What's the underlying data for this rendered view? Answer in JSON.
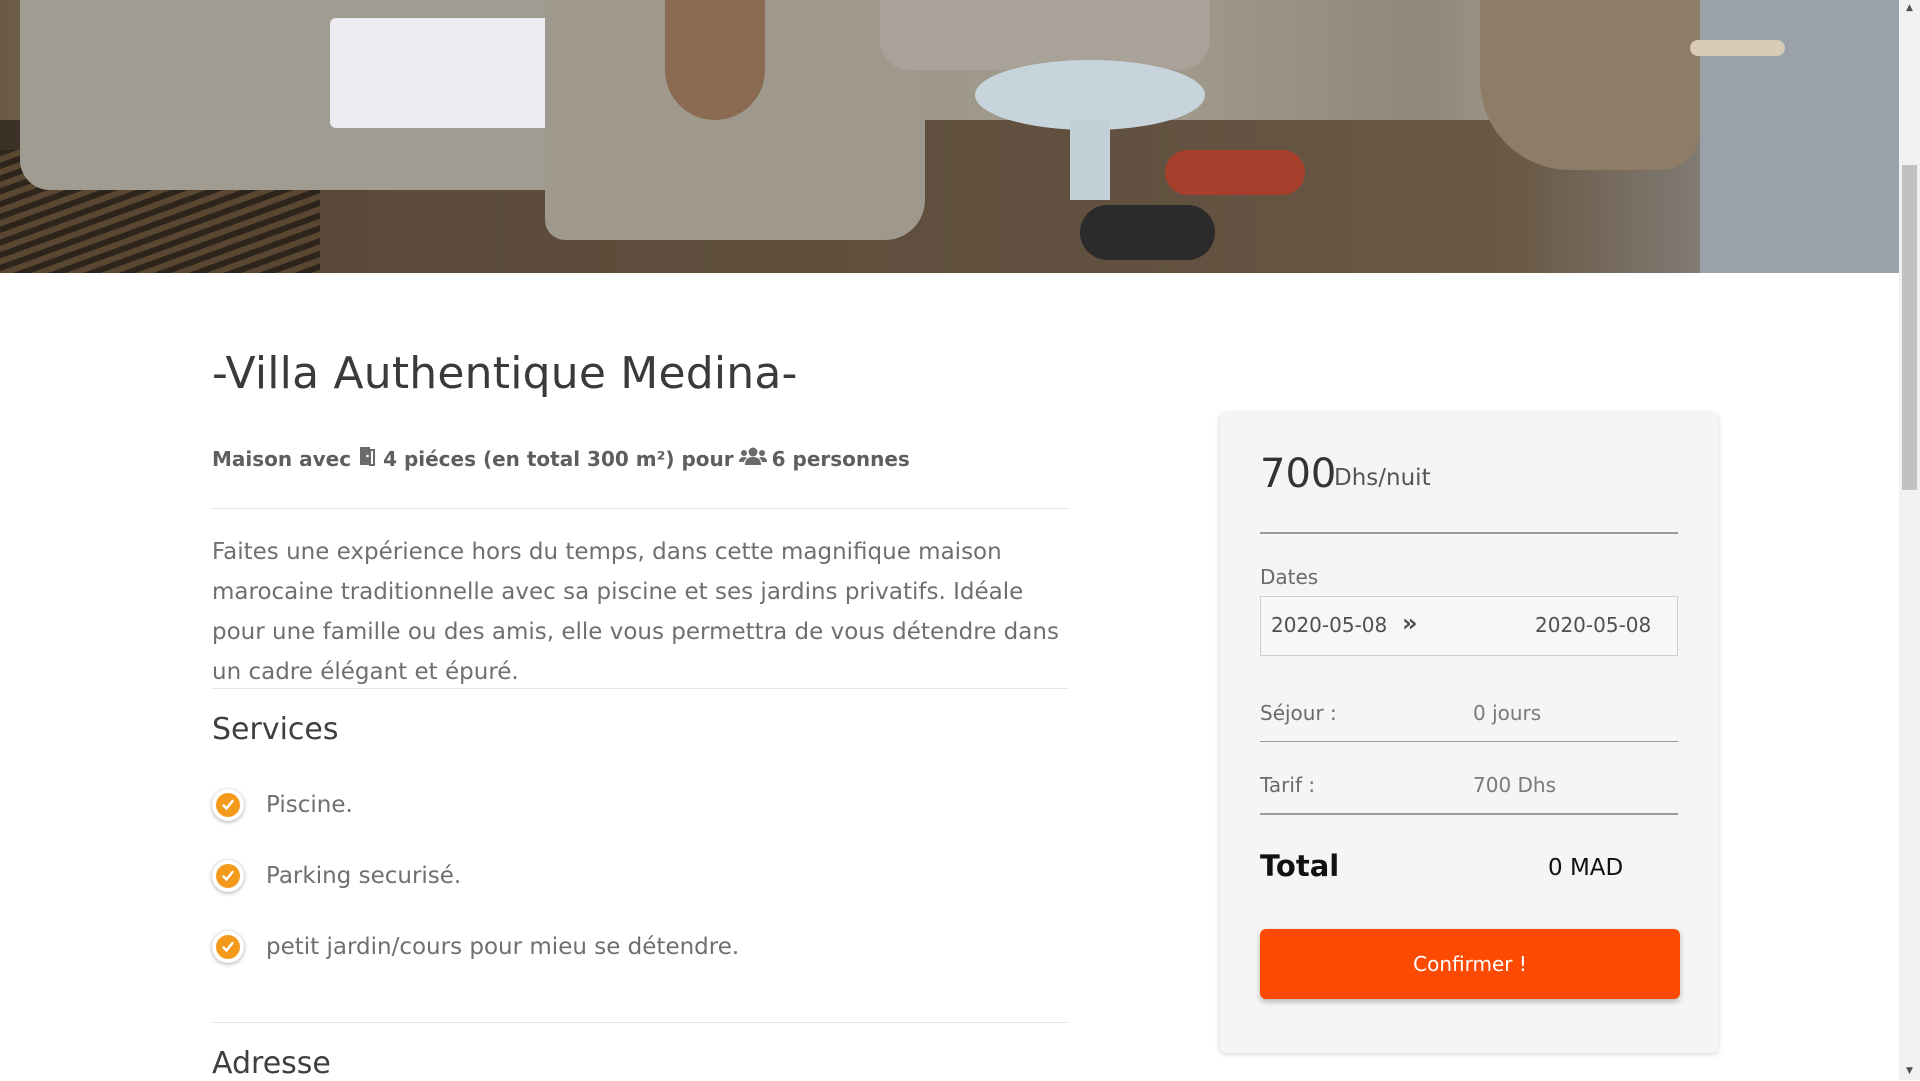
{
  "property": {
    "title": "-Villa Authentique Medina-",
    "meta": {
      "prefix": "Maison avec",
      "rooms": "4 piéces (en total 300 m²) pour",
      "guests": "6 personnes"
    },
    "description": "Faites une expérience hors du temps, dans cette magnifique maison marocaine traditionnelle avec sa piscine et ses jardins privatifs. Idéale pour une famille ou des amis, elle vous permettra de vous détendre dans un cadre élégant et épuré."
  },
  "services": {
    "heading": "Services",
    "items": [
      {
        "label": "Piscine."
      },
      {
        "label": "Parking securisé."
      },
      {
        "label": "petit jardin/cours pour mieu se détendre."
      }
    ]
  },
  "address": {
    "heading": "Adresse"
  },
  "booking": {
    "price": "700",
    "price_unit": "Dhs/nuit",
    "dates_label": "Dates",
    "date_start": "2020-05-08",
    "date_arrow": "»",
    "date_end": "2020-05-08",
    "stay_label": "Séjour :",
    "stay_value": "0 jours",
    "rate_label": "Tarif :",
    "rate_value": "700 Dhs",
    "total_label": "Total",
    "total_value": "0 MAD",
    "confirm_label": "Confirmer !"
  },
  "colors": {
    "accent_orange": "#fd4a03",
    "check_orange": "#f49a1b"
  },
  "icons": {
    "rooms": "door-icon",
    "guests": "users-icon",
    "service": "check-circle-icon"
  }
}
